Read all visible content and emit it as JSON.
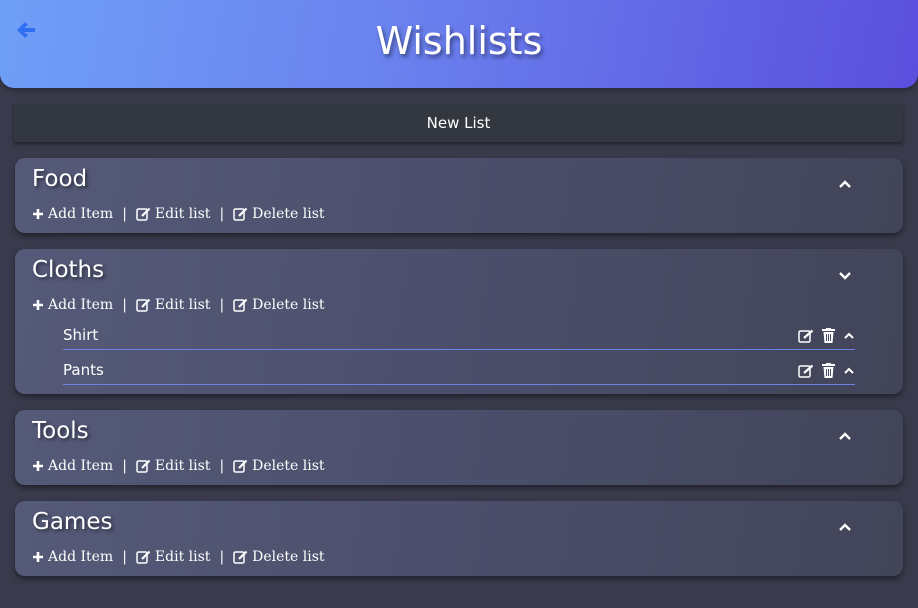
{
  "header": {
    "title": "Wishlists"
  },
  "new_list": {
    "label": "New List"
  },
  "actions": {
    "add_item": "Add Item",
    "edit_list": "Edit list",
    "delete_list": "Delete list",
    "separator": "|"
  },
  "lists": [
    {
      "name": "Food",
      "expanded": false,
      "items": []
    },
    {
      "name": "Cloths",
      "expanded": true,
      "items": [
        {
          "name": "Shirt"
        },
        {
          "name": "Pants"
        }
      ]
    },
    {
      "name": "Tools",
      "expanded": false,
      "items": []
    },
    {
      "name": "Games",
      "expanded": false,
      "items": []
    }
  ],
  "colors": {
    "header_start": "#6f9ff7",
    "header_end": "#5a4fdd",
    "background": "#393b4d",
    "back_arrow": "#2f6ff0",
    "item_underline": "#6a82e6"
  }
}
